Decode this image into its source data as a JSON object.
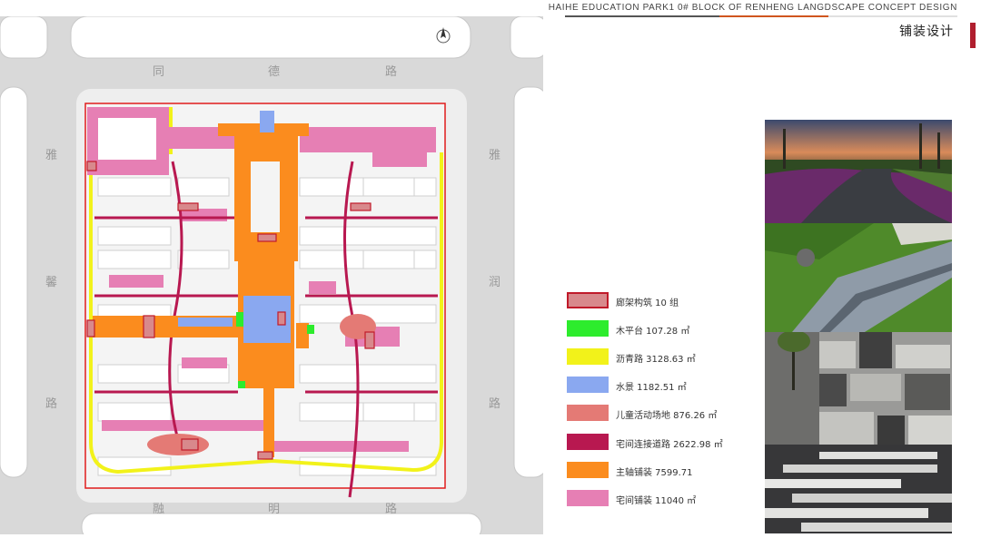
{
  "header": {
    "title": "HAIHE EDUCATION PARK1 0# BLOCK OF RENHENG LANGDSCAPE CONCEPT DESIGN",
    "section": "铺装设计"
  },
  "map": {
    "road_labels": {
      "top": [
        "同",
        "德",
        "路"
      ],
      "left": [
        "雅",
        "馨",
        "路"
      ],
      "right": [
        "雅",
        "润",
        "路"
      ],
      "bottom": [
        "融",
        "明",
        "路"
      ]
    },
    "colors": {
      "pergola": "#d8898c",
      "wood_deck": "#2dec2d",
      "asphalt": "#f2f21a",
      "water": "#8aa8f0",
      "children": "#e47a75",
      "connector": "#b81850",
      "main_axis": "#fb8c1e",
      "house_paving": "#e67fb4"
    }
  },
  "legend": {
    "items": [
      {
        "label": "廊架构筑  10 组",
        "color": "#d8898c",
        "border": "#c01a2a"
      },
      {
        "label": "木平台 107.28 ㎡",
        "color": "#2dec2d",
        "border": ""
      },
      {
        "label": "沥青路 3128.63 ㎡",
        "color": "#f2f21a",
        "border": ""
      },
      {
        "label": "水景  1182.51 ㎡",
        "color": "#8aa8f0",
        "border": ""
      },
      {
        "label": "儿童活动场地 876.26 ㎡",
        "color": "#e47a75",
        "border": ""
      },
      {
        "label": "宅间连接道路 2622.98 ㎡",
        "color": "#b81850",
        "border": ""
      },
      {
        "label": "主轴铺装 7599.71",
        "color": "#fb8c1e",
        "border": ""
      },
      {
        "label": "宅间铺装 11040 ㎡",
        "color": "#e67fb4",
        "border": ""
      }
    ]
  },
  "photos": [
    {
      "name": "asphalt-road-photo"
    },
    {
      "name": "stepped-paving-photo"
    },
    {
      "name": "stone-paving-photo"
    },
    {
      "name": "strip-paving-photo"
    }
  ]
}
